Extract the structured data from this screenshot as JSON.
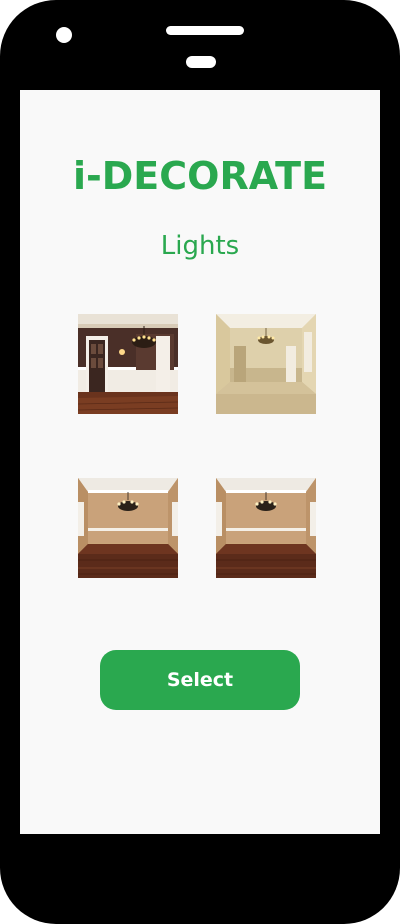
{
  "app": {
    "title": "i-DECORATE"
  },
  "screen": {
    "section_title": "Lights"
  },
  "gallery": {
    "items": [
      {
        "icon": "room-dark-walls-chandelier"
      },
      {
        "icon": "room-beige-carpet-chandelier"
      },
      {
        "icon": "room-tan-walls-wood-floor-chandelier"
      },
      {
        "icon": "room-tan-walls-wood-floor-chandelier"
      }
    ]
  },
  "actions": {
    "select_label": "Select"
  },
  "colors": {
    "accent": "#2aa84f",
    "screen_bg": "#f9f9f9",
    "device_frame": "#000000"
  }
}
